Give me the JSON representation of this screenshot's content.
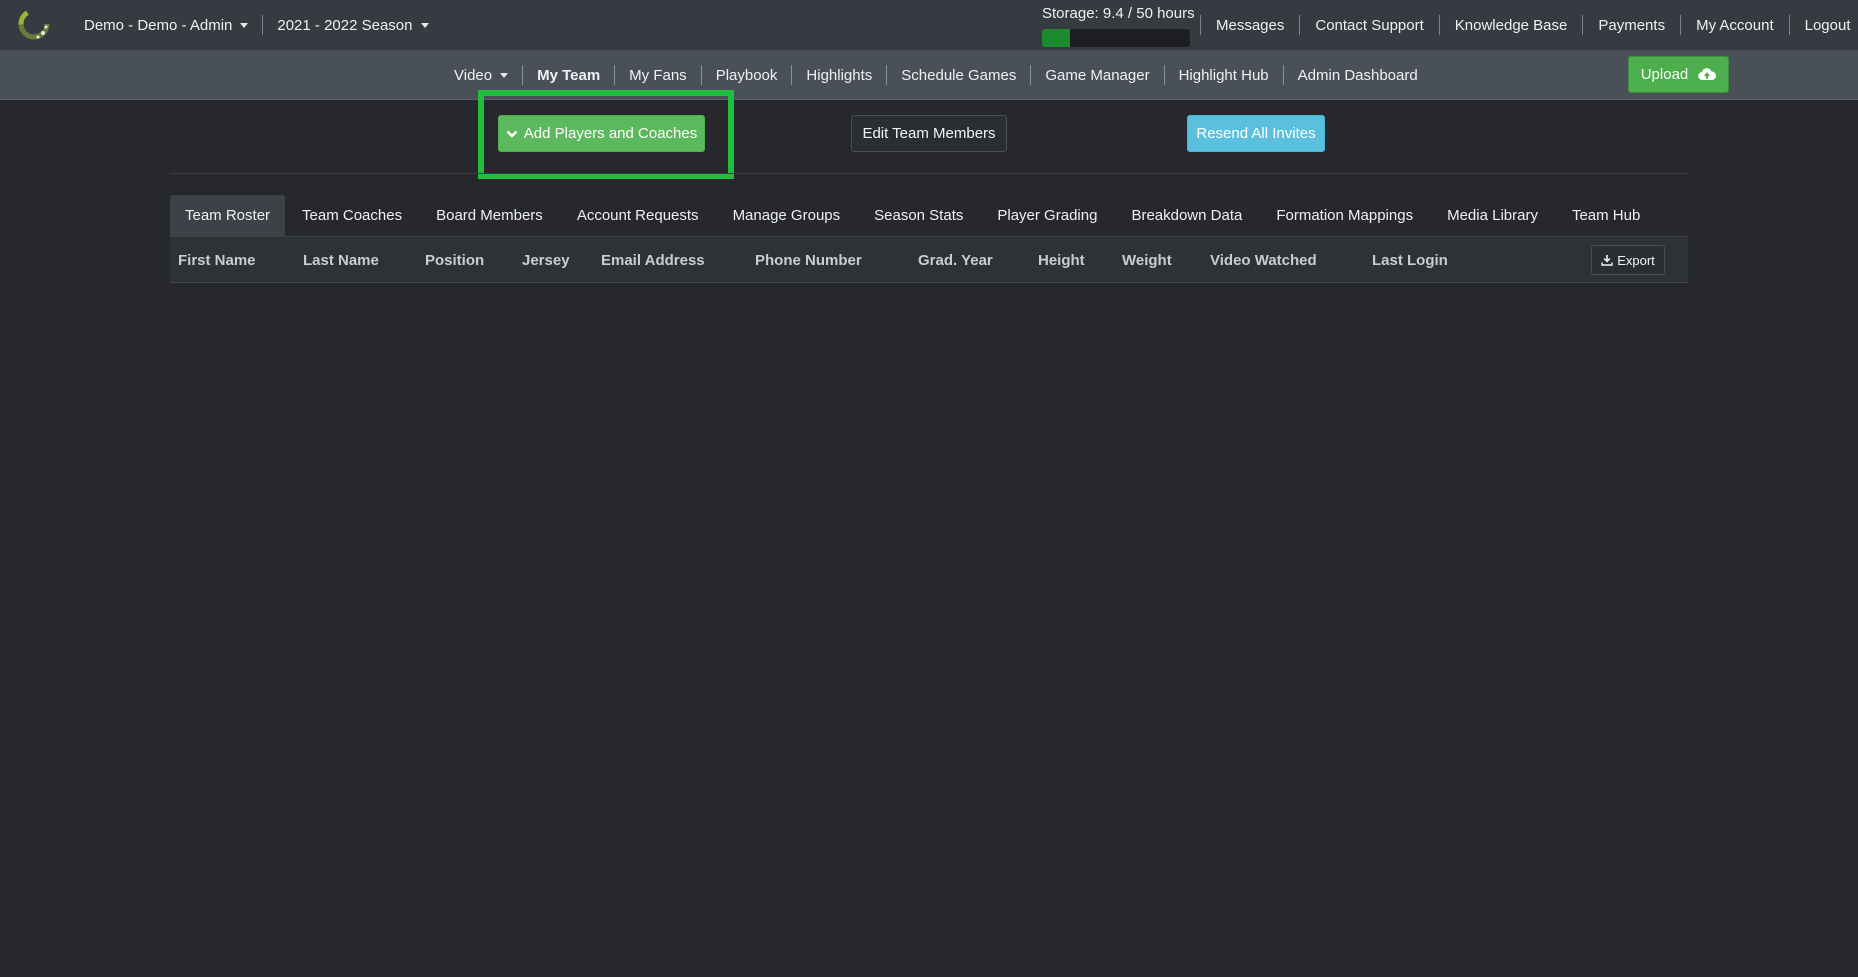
{
  "topbar": {
    "account_menu": "Demo - Demo - Admin",
    "season_menu": "2021 - 2022 Season",
    "storage": {
      "label": "Storage: 9.4 / 50 hours",
      "used_fraction": 0.188
    },
    "links": [
      "Messages",
      "Contact Support",
      "Knowledge Base",
      "Payments",
      "My Account",
      "Logout"
    ]
  },
  "subnav": {
    "items": [
      "Video",
      "My Team",
      "My Fans",
      "Playbook",
      "Highlights",
      "Schedule Games",
      "Game Manager",
      "Highlight Hub",
      "Admin Dashboard"
    ],
    "active": "My Team",
    "upload_label": "Upload"
  },
  "actions": {
    "add_label": "Add Players and Coaches",
    "edit_label": "Edit Team Members",
    "resend_label": "Resend All Invites"
  },
  "tabs": [
    "Team Roster",
    "Team Coaches",
    "Board Members",
    "Account Requests",
    "Manage Groups",
    "Season Stats",
    "Player Grading",
    "Breakdown Data",
    "Formation Mappings",
    "Media Library",
    "Team Hub"
  ],
  "active_tab": "Team Roster",
  "table": {
    "columns": [
      "First Name",
      "Last Name",
      "Position",
      "Jersey",
      "Email Address",
      "Phone Number",
      "Grad. Year",
      "Height",
      "Weight",
      "Video Watched",
      "Last Login"
    ],
    "export_label": "Export"
  },
  "colors": {
    "highlight_box": "#1fbf3e",
    "upload_green": "#4cae4c",
    "resend_blue": "#5bc0de",
    "storage_green": "#1e8a2e"
  }
}
